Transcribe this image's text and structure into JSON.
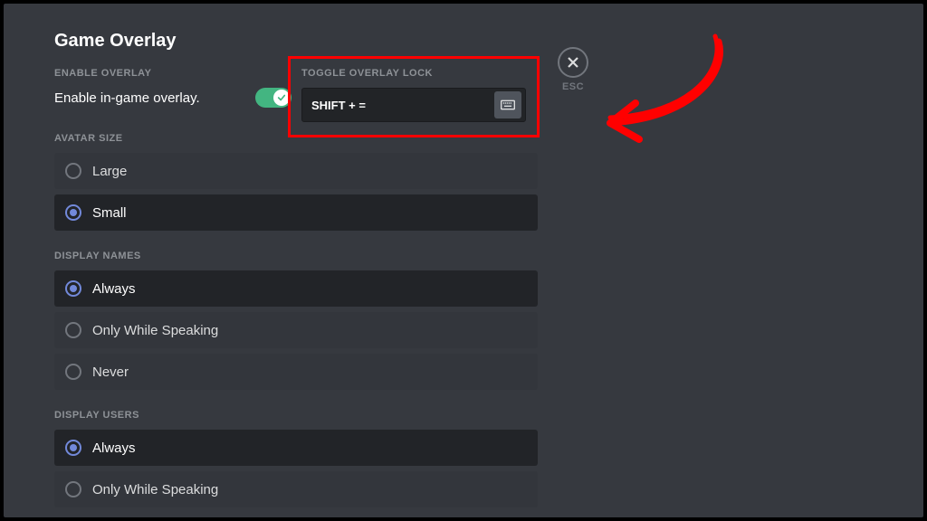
{
  "page": {
    "title": "Game Overlay"
  },
  "enable": {
    "section_label": "ENABLE OVERLAY",
    "text": "Enable in-game overlay.",
    "on": true
  },
  "toggle_lock": {
    "section_label": "TOGGLE OVERLAY LOCK",
    "keybind": "SHIFT + ="
  },
  "close": {
    "label": "ESC"
  },
  "avatar_size": {
    "section_label": "AVATAR SIZE",
    "options": [
      {
        "label": "Large",
        "selected": false
      },
      {
        "label": "Small",
        "selected": true
      }
    ]
  },
  "display_names": {
    "section_label": "DISPLAY NAMES",
    "options": [
      {
        "label": "Always",
        "selected": true
      },
      {
        "label": "Only While Speaking",
        "selected": false
      },
      {
        "label": "Never",
        "selected": false
      }
    ]
  },
  "display_users": {
    "section_label": "DISPLAY USERS",
    "options": [
      {
        "label": "Always",
        "selected": true
      },
      {
        "label": "Only While Speaking",
        "selected": false
      }
    ]
  }
}
